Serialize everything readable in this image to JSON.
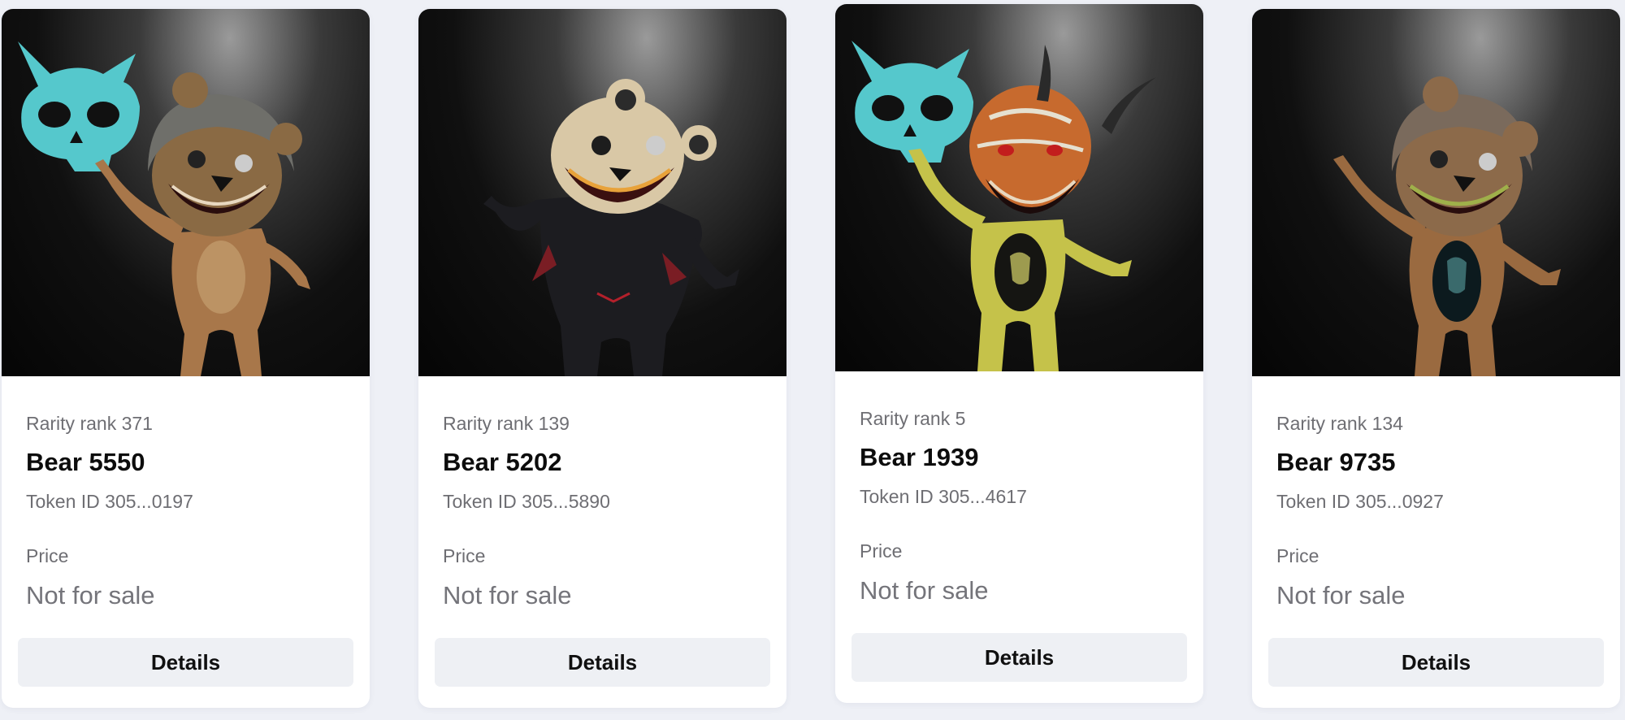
{
  "cards": [
    {
      "rarity": "Rarity rank 371",
      "title": "Bear 5550",
      "token": "Token ID 305...0197",
      "price_label": "Price",
      "price_value": "Not for sale",
      "button_label": "Details",
      "image": {
        "body_color": "#a8774a",
        "head_color": "#8a6a44",
        "has_skull": true,
        "skull_color": "#55c8cc",
        "hood": true
      }
    },
    {
      "rarity": "Rarity rank 139",
      "title": "Bear 5202",
      "token": "Token ID 305...5890",
      "price_label": "Price",
      "price_value": "Not for sale",
      "button_label": "Details",
      "image": {
        "body_color": "#1c1c20",
        "head_color": "#d9c8a6",
        "has_skull": false,
        "skull_color": "#55c8cc",
        "hood": false
      }
    },
    {
      "rarity": "Rarity rank 5",
      "title": "Bear 1939",
      "token": "Token ID 305...4617",
      "price_label": "Price",
      "price_value": "Not for sale",
      "button_label": "Details",
      "image": {
        "body_color": "#c5c24a",
        "head_color": "#c76a2e",
        "has_skull": true,
        "skull_color": "#55c8cc",
        "hood": false
      }
    },
    {
      "rarity": "Rarity rank 134",
      "title": "Bear 9735",
      "token": "Token ID 305...0927",
      "price_label": "Price",
      "price_value": "Not for sale",
      "button_label": "Details",
      "image": {
        "body_color": "#9a6a40",
        "head_color": "#8c6a4a",
        "has_skull": false,
        "skull_color": "#55c8cc",
        "hood": true
      }
    }
  ]
}
